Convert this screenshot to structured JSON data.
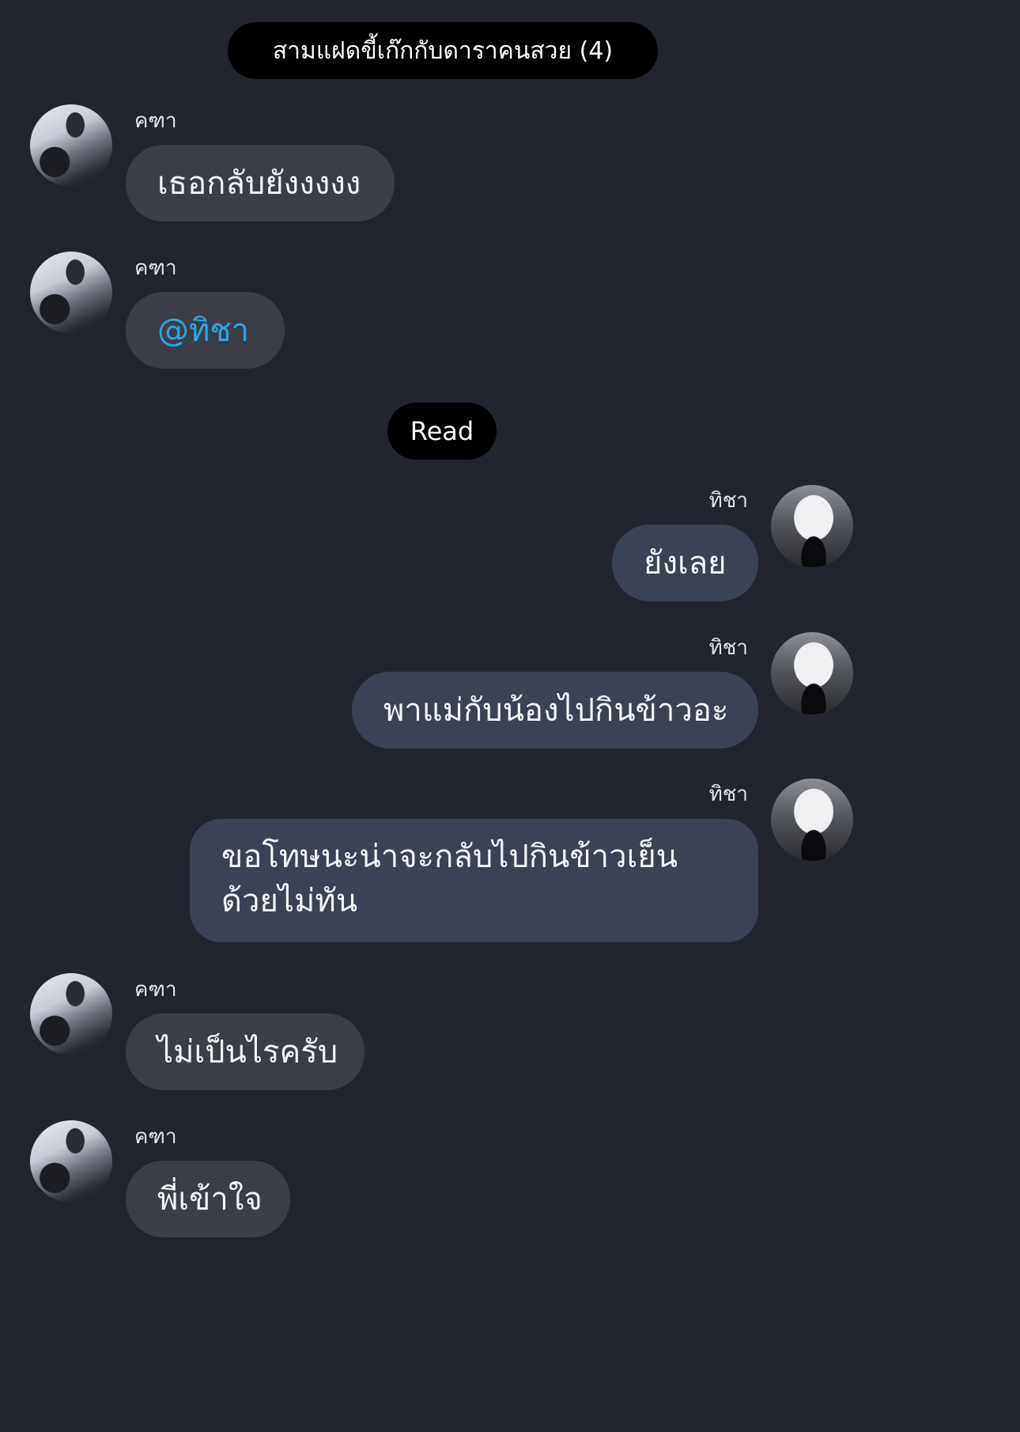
{
  "chat": {
    "title": "สามแฝดขี้เก๊กกับดาราคนสวย (4)",
    "read_label": "Read"
  },
  "messages": [
    {
      "sender": "คฑา",
      "text": "เธอกลับยังงงงง",
      "side": "left"
    },
    {
      "sender": "คฑา",
      "text": "@ทิชา",
      "side": "left",
      "mention": true
    },
    {
      "sender": "ทิชา",
      "text": "ยังเลย",
      "side": "right"
    },
    {
      "sender": "ทิชา",
      "text": "พาแม่กับน้องไปกินข้าวอะ",
      "side": "right"
    },
    {
      "sender": "ทิชา",
      "text": "ขอโทษนะน่าจะกลับไปกินข้าวเย็นด้วยไม่ทัน",
      "side": "right"
    },
    {
      "sender": "คฑา",
      "text": "ไม่เป็นไรครับ",
      "side": "left"
    },
    {
      "sender": "คฑา",
      "text": "พี่เข้าใจ",
      "side": "left"
    }
  ],
  "colors": {
    "background": "#22252e",
    "incoming_bubble": "#3b3e47",
    "outgoing_bubble": "#3a4253",
    "mention": "#2aa7e8",
    "pill": "#000000"
  }
}
